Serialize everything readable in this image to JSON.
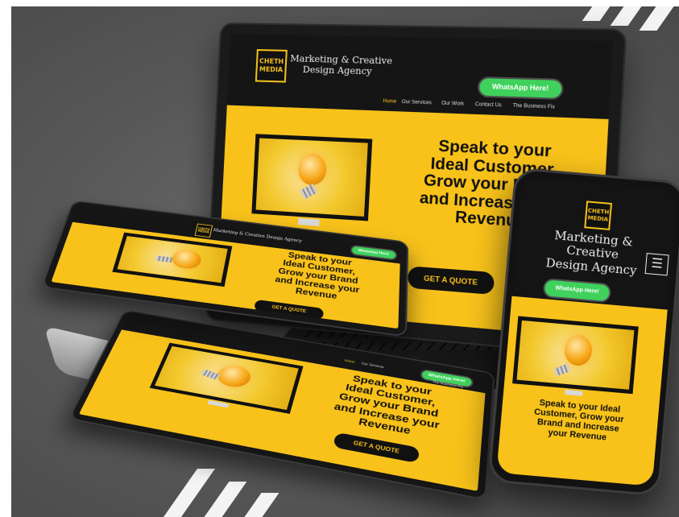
{
  "brand": {
    "logo_line1": "CHETH",
    "logo_line2": "MEDIA",
    "name": "Marketing & Creative Design Agency",
    "name_line1": "Marketing &",
    "name_line2": "Creative",
    "name_line3": "Design Agency",
    "laptop_line1": "Marketing & Creative",
    "laptop_line2": "Design Agency"
  },
  "nav": {
    "items": [
      "Home",
      "Our Services",
      "Our Work",
      "Contact Us",
      "The Business Fix"
    ]
  },
  "cta": {
    "whatsapp": "WhatsApp Here!",
    "quote": "GET A QUOTE"
  },
  "hero": {
    "laptop_lines": [
      "Speak to your",
      "Ideal Customer,",
      "Grow your Brand",
      "and Increase your",
      "Revenue"
    ],
    "tablet_lines": [
      "Speak to your",
      "Ideal Customer,",
      "Grow your Brand",
      "and Increase your",
      "Revenue"
    ],
    "phone_lines": [
      "Speak to your Ideal",
      "Customer, Grow your",
      "Brand and Increase",
      "your Revenue"
    ]
  },
  "icons": {
    "menu": "☰"
  },
  "colors": {
    "brand_yellow": "#f8c21a",
    "whatsapp_green": "#3fd15c",
    "dark": "#141414",
    "background": "#575757"
  }
}
